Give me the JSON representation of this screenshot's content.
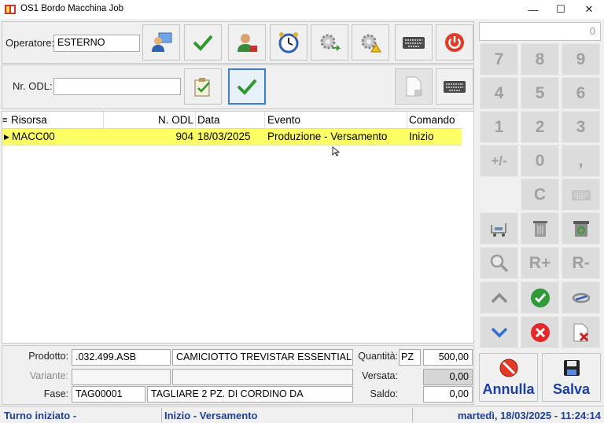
{
  "window": {
    "title": "OS1 Bordo Macchina Job",
    "minimize": "—",
    "maximize": "☐",
    "close": "✕"
  },
  "operator": {
    "label": "Operatore:",
    "value": "ESTERNO"
  },
  "odl": {
    "label": "Nr. ODL:",
    "value": ""
  },
  "grid": {
    "columns": [
      "Risorsa",
      "N. ODL",
      "Data",
      "Evento",
      "Comando"
    ],
    "rows": [
      {
        "risorsa": "MACC00",
        "odl": "904",
        "data": "18/03/2025",
        "evento": "Produzione - Versamento",
        "comando": "Inizio"
      }
    ]
  },
  "details": {
    "prodotto_label": "Prodotto:",
    "prodotto_code": ".032.499.ASB",
    "prodotto_desc": "CAMICIOTTO TREVISTAR ESSENTIAL T",
    "variante_label": "Variante:",
    "variante_code": "",
    "variante_desc": "",
    "fase_label": "Fase:",
    "fase_code": "TAG00001",
    "fase_desc": "TAGLIARE 2 PZ. DI CORDINO DA",
    "quantita_label": "Quantità:",
    "um": "PZ",
    "quantita": "500,00",
    "versata_label": "Versata:",
    "versata": "0,00",
    "saldo_label": "Saldo:",
    "saldo": "0,00"
  },
  "keypad": {
    "display": "0",
    "keys": [
      "7",
      "8",
      "9",
      "4",
      "5",
      "6",
      "1",
      "2",
      "3",
      "+/-",
      "0",
      ",",
      "C",
      "R+",
      "R-"
    ],
    "annulla": "Annulla",
    "salva": "Salva"
  },
  "status": {
    "left": "Turno iniziato -",
    "middle": "Inizio - Versamento",
    "right": "martedì, 18/03/2025 - 11:24:14"
  },
  "colors": {
    "row_highlight": "#ffff66",
    "accent_blue": "#1b3fa8",
    "green_check": "#3a9a3a",
    "red": "#d02020"
  }
}
